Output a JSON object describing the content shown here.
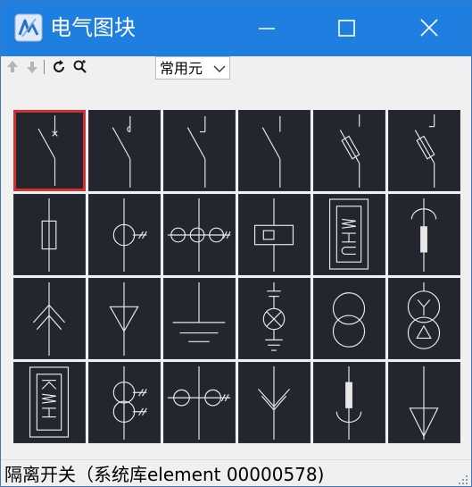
{
  "window": {
    "title": "电气图块",
    "icon": "app-icon",
    "controls": {
      "minimize": "minimize-icon",
      "maximize": "maximize-icon",
      "close": "close-icon"
    }
  },
  "toolbar": {
    "buttons": [
      "up-arrow-icon",
      "down-arrow-icon",
      "refresh-icon",
      "zoom-icon"
    ],
    "category_selected": "常用元"
  },
  "symbols": [
    "isolating-switch",
    "switch-disconnector",
    "switch-contactor",
    "switch-circuit-breaker",
    "fuse-switch",
    "fuse-switch-2",
    "fuse",
    "current-transformer",
    "current-transformer-triple",
    "relay-coil",
    "watt-hour-meter",
    "terminal-cable-head",
    "arrow-up-symbol",
    "delta-triangle-down",
    "ground",
    "indicator-lamp",
    "transformer",
    "transformer-y-delta",
    "kwh-meter",
    "current-transformer-double",
    "current-transformer-pair",
    "arrow-down-symbol",
    "cable-terminal-bottom",
    "triangle-down-bottom"
  ],
  "selected_index": 0,
  "status": {
    "text": "隔离开关（系统库element 00000578)"
  },
  "colors": {
    "titlebar": "#1f7fe0",
    "cell_bg": "#23262e",
    "selected_border": "#d0312d",
    "symbol_line": "#e8e8e8"
  }
}
